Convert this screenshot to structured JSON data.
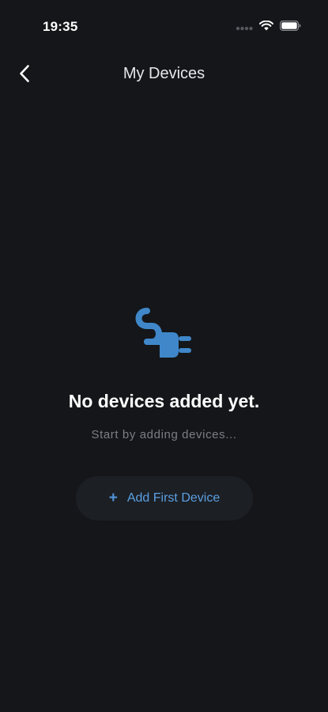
{
  "status_bar": {
    "time": "19:35",
    "signal_icon": "signal-dots-icon",
    "wifi_icon": "wifi-icon",
    "battery_icon": "battery-icon"
  },
  "nav": {
    "back_icon": "chevron-left-icon",
    "title": "My Devices"
  },
  "empty_state": {
    "icon": "plug-icon",
    "title": "No devices added yet.",
    "subtitle": "Start by adding devices..."
  },
  "add_button": {
    "icon_glyph": "+",
    "label": "Add First Device"
  },
  "colors": {
    "background": "#141619",
    "accent": "#4e95d9",
    "button_bg": "#1c1f24",
    "subtitle": "#7b7e84"
  }
}
